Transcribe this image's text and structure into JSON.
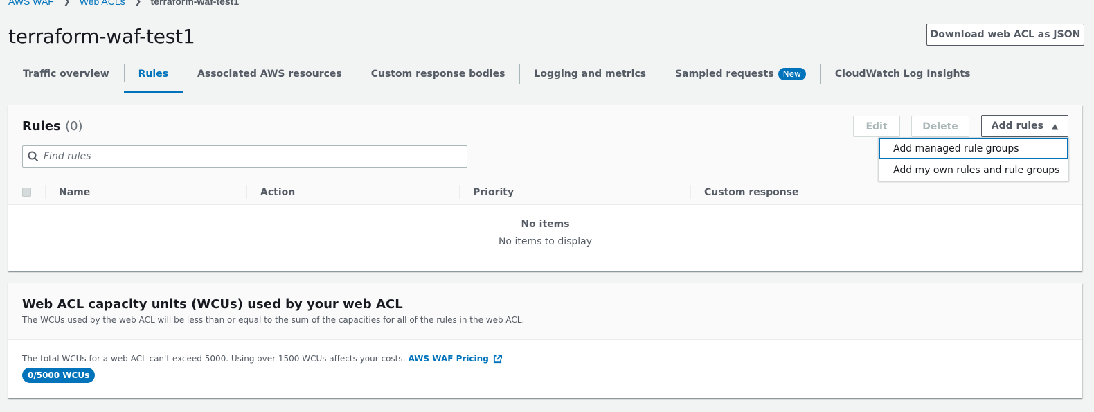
{
  "breadcrumb": {
    "items": [
      "AWS WAF",
      "Web ACLs"
    ],
    "current": "terraform-waf-test1"
  },
  "page": {
    "title": "terraform-waf-test1",
    "download_label": "Download web ACL as JSON"
  },
  "tabs": [
    {
      "label": "Traffic overview"
    },
    {
      "label": "Rules",
      "active": true
    },
    {
      "label": "Associated AWS resources"
    },
    {
      "label": "Custom response bodies"
    },
    {
      "label": "Logging and metrics"
    },
    {
      "label": "Sampled requests",
      "badge": "New"
    },
    {
      "label": "CloudWatch Log Insights"
    }
  ],
  "rules": {
    "title": "Rules",
    "count": "(0)",
    "edit_label": "Edit",
    "delete_label": "Delete",
    "add_label": "Add rules",
    "search_placeholder": "Find rules",
    "columns": [
      "Name",
      "Action",
      "Priority",
      "Custom response"
    ],
    "empty_title": "No items",
    "empty_desc": "No items to display"
  },
  "add_menu": {
    "items": [
      "Add managed rule groups",
      "Add my own rules and rule groups"
    ],
    "highlighted_index": 0
  },
  "wcu": {
    "title": "Web ACL capacity units (WCUs) used by your web ACL",
    "desc": "The WCUs used by the web ACL will be less than or equal to the sum of the capacities for all of the rules in the web ACL.",
    "note": "The total WCUs for a web ACL can't exceed 5000. Using over 1500 WCUs affects your costs.",
    "pricing_link": "AWS WAF Pricing",
    "usage_badge": "0/5000 WCUs"
  },
  "colors": {
    "accent": "#0073bb",
    "background": "#f2f3f3"
  }
}
